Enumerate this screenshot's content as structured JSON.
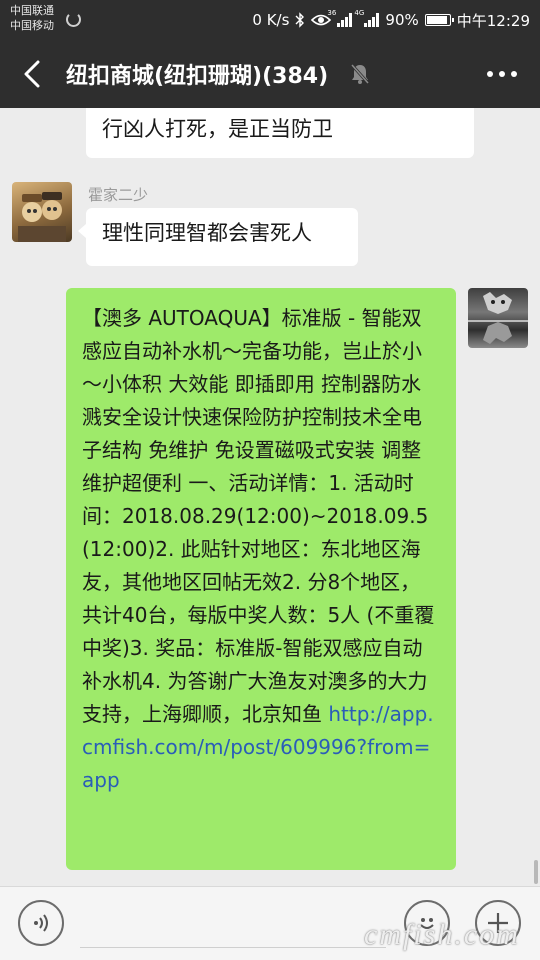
{
  "status_bar": {
    "carrier_1": "中国联通",
    "carrier_2": "中国移动",
    "net_speed": "0 K/s",
    "signal_tag_1": "36",
    "signal_tag_2": "4G",
    "battery": "90%",
    "battery_level": 0.9,
    "time": "中午12:29"
  },
  "header": {
    "title": "纽扣商城(纽扣珊瑚)(384)",
    "back_icon": "chevron-left-icon",
    "muted_icon": "mute-bell-icon",
    "more_icon": "more-dots-icon"
  },
  "messages": [
    {
      "direction": "in",
      "text": "行凶人打死，是正当防卫"
    },
    {
      "direction": "in",
      "sender": "霍家二少",
      "text": "理性同理智都会害死人"
    },
    {
      "direction": "out",
      "text": "【澳多 AUTOAQUA】标准版 - 智能双感应自动补水机～完备功能，岂止於小～小体积 大效能 即插即用 控制器防水溅安全设计快速保险防护控制技术全电子结构 免维护 免设置磁吸式安装 调整维护超便利 一、活动详情：1. 活动时间：2018.08.29(12:00)~2018.09.5(12:00)2. 此贴针对地区：东北地区海友，其他地区回帖无效2. 分8个地区，共计40台，每版中奖人数：5人 (不重覆中奖)3. 奖品：标准版-智能双感应自动补水机4. 为答谢广大渔友对澳多的大力支持，上海卿顺，北京知鱼 ",
      "link": "http://app.cmfish.com/m/post/609996?from=app"
    }
  ],
  "input_bar": {
    "voice_icon": "voice-wave-icon",
    "emoji_icon": "emoji-smile-icon",
    "plus_icon": "plus-icon",
    "input_value": "",
    "watermark": "cmfish.com"
  },
  "colors": {
    "header_bg": "#2e2e2e",
    "chat_bg": "#ececec",
    "bubble_out": "#9eea6a",
    "bubble_in": "#ffffff",
    "link": "#2a5db8"
  }
}
